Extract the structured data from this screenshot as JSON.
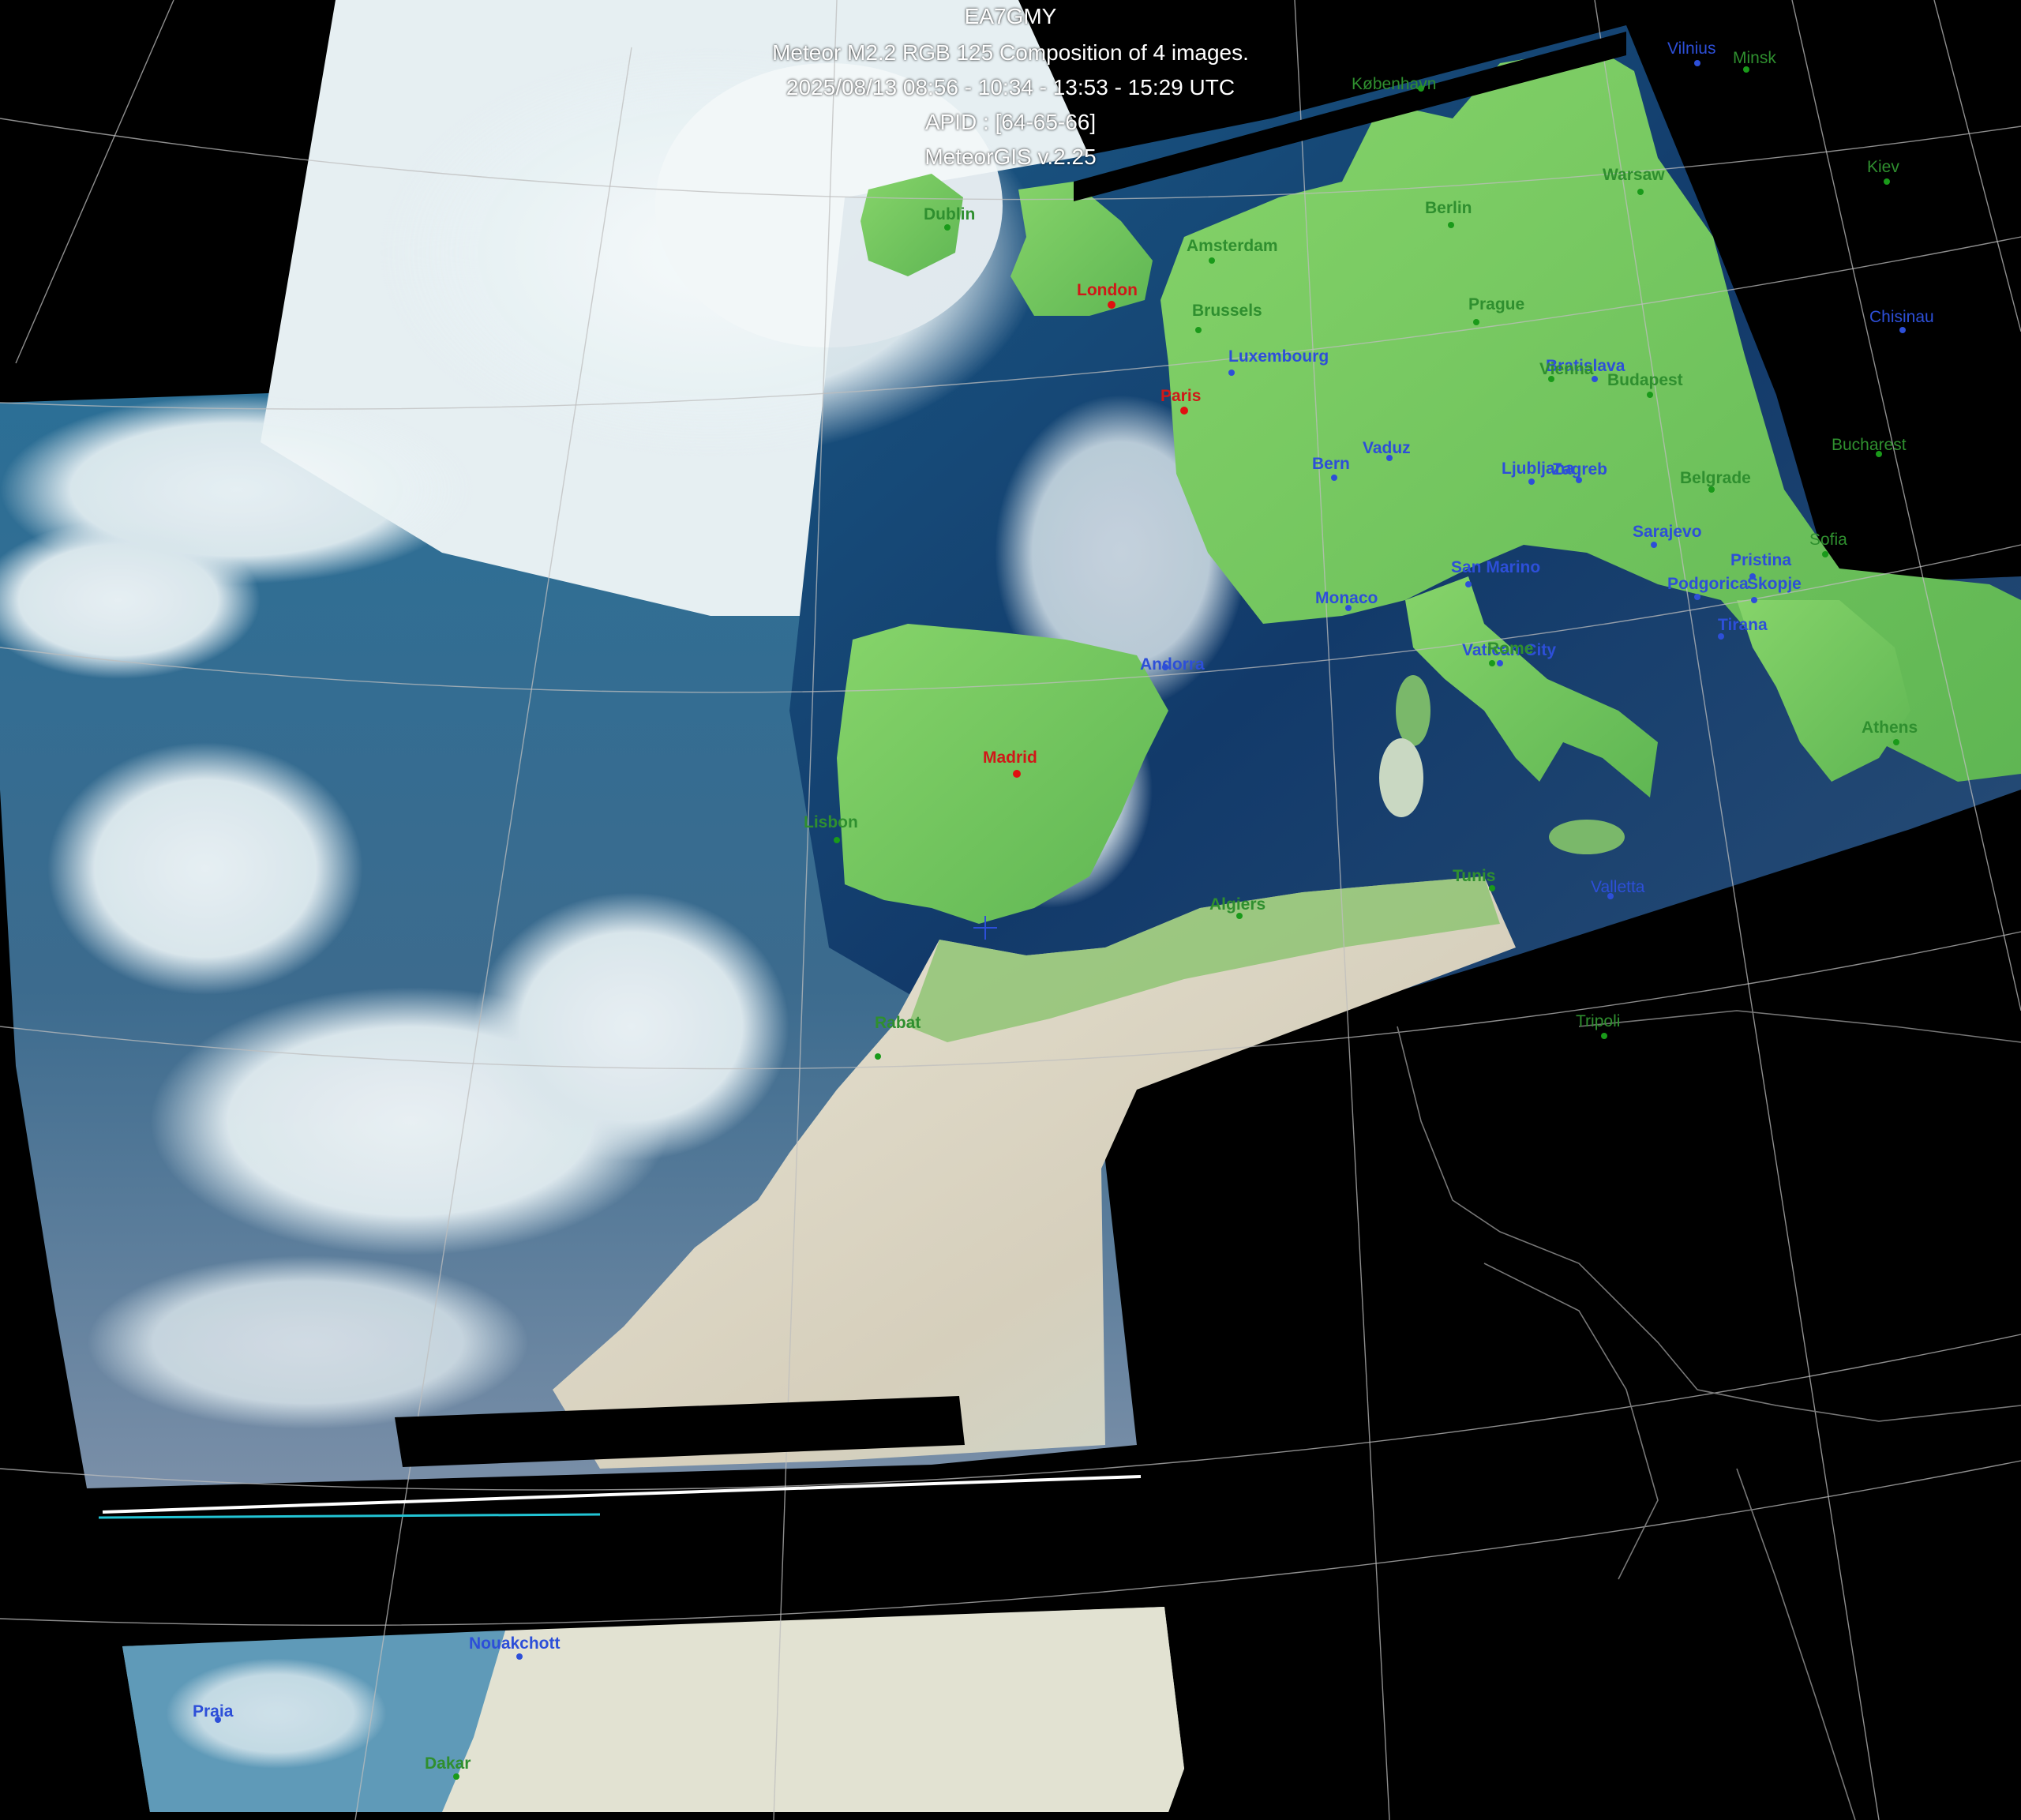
{
  "header": {
    "station": "EA7GMY",
    "product": "Meteor M2.2 RGB 125 Composition of 4 images.",
    "times": "2025/08/13 08:56 - 10:34 - 13:53 - 15:29 UTC",
    "apid": "APID : [64-65-66]",
    "software": "MeteorGIS v.2.25"
  },
  "colors": {
    "land": "#73c85c",
    "ocean": "#0e2a52",
    "cloud": "#eef6f8",
    "desert": "#d9d3c0",
    "label_green": "#2f8f2f",
    "label_blue": "#2d4fd8",
    "label_red": "#d01818"
  },
  "cities": [
    {
      "name": "Vilnius",
      "color": "blue"
    },
    {
      "name": "Minsk",
      "color": "green"
    },
    {
      "name": "København",
      "color": "green"
    },
    {
      "name": "Kiev",
      "color": "green"
    },
    {
      "name": "Warsaw",
      "color": "green"
    },
    {
      "name": "Dublin",
      "color": "green"
    },
    {
      "name": "Berlin",
      "color": "green"
    },
    {
      "name": "Amsterdam",
      "color": "green"
    },
    {
      "name": "London",
      "color": "red"
    },
    {
      "name": "Brussels",
      "color": "green"
    },
    {
      "name": "Prague",
      "color": "green"
    },
    {
      "name": "Chisinau",
      "color": "blue"
    },
    {
      "name": "Luxembourg",
      "color": "blue"
    },
    {
      "name": "Bratislava",
      "color": "blue"
    },
    {
      "name": "Vienna",
      "color": "green"
    },
    {
      "name": "Budapest",
      "color": "green"
    },
    {
      "name": "Paris",
      "color": "red"
    },
    {
      "name": "Bucharest",
      "color": "green"
    },
    {
      "name": "Bern",
      "color": "blue"
    },
    {
      "name": "Vaduz",
      "color": "blue"
    },
    {
      "name": "Ljubljana",
      "color": "blue"
    },
    {
      "name": "Zagreb",
      "color": "blue"
    },
    {
      "name": "Belgrade",
      "color": "green"
    },
    {
      "name": "Sarajevo",
      "color": "blue"
    },
    {
      "name": "Sofia",
      "color": "green"
    },
    {
      "name": "San Marino",
      "color": "blue"
    },
    {
      "name": "Pristina",
      "color": "blue"
    },
    {
      "name": "Podgorica",
      "color": "blue"
    },
    {
      "name": "Skopje",
      "color": "blue"
    },
    {
      "name": "Monaco",
      "color": "blue"
    },
    {
      "name": "Tirana",
      "color": "blue"
    },
    {
      "name": "Andorra",
      "color": "blue"
    },
    {
      "name": "Vatican City",
      "color": "blue"
    },
    {
      "name": "Rome",
      "color": "green"
    },
    {
      "name": "Athens",
      "color": "green"
    },
    {
      "name": "Madrid",
      "color": "red"
    },
    {
      "name": "Lisbon",
      "color": "green"
    },
    {
      "name": "Tunis",
      "color": "green"
    },
    {
      "name": "Valletta",
      "color": "blue"
    },
    {
      "name": "Algiers",
      "color": "green"
    },
    {
      "name": "Rabat",
      "color": "green"
    },
    {
      "name": "Tripoli",
      "color": "green"
    },
    {
      "name": "Nouakchott",
      "color": "blue"
    },
    {
      "name": "Praia",
      "color": "blue"
    },
    {
      "name": "Dakar",
      "color": "green"
    }
  ]
}
